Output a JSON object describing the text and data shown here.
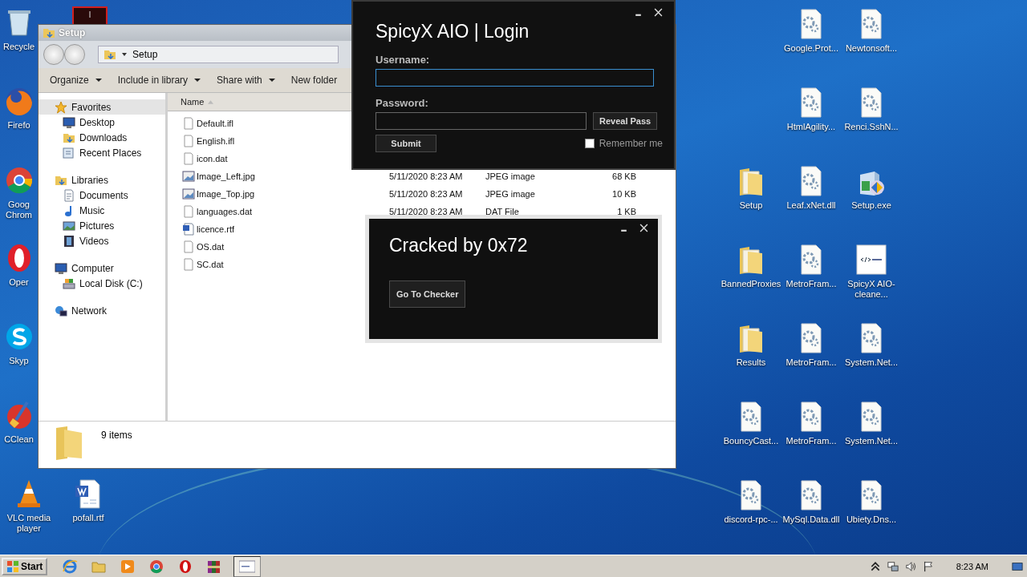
{
  "desktop_left": [
    {
      "label": "Recycle",
      "kind": "recycle"
    },
    {
      "label": "Firefo",
      "kind": "firefox"
    },
    {
      "label": "Goog Chrom",
      "kind": "chrome"
    },
    {
      "label": "Oper",
      "kind": "opera"
    },
    {
      "label": "Skyp",
      "kind": "skype"
    },
    {
      "label": "CClean",
      "kind": "ccleaner"
    },
    {
      "label": "VLC media player",
      "kind": "vlc"
    },
    {
      "label": "pofall.rtf",
      "kind": "word"
    }
  ],
  "desktop_right": [
    {
      "label": "Setup",
      "kind": "folder"
    },
    {
      "label": "BannedProxies",
      "kind": "folder"
    },
    {
      "label": "Results",
      "kind": "folder"
    },
    {
      "label": "BouncyCast...",
      "kind": "dll"
    },
    {
      "label": "discord-rpc-...",
      "kind": "dll"
    },
    {
      "label": "Google.Prot...",
      "kind": "dll"
    },
    {
      "label": "HtmlAgility...",
      "kind": "dll"
    },
    {
      "label": "Leaf.xNet.dll",
      "kind": "dll"
    },
    {
      "label": "MetroFram...",
      "kind": "dll"
    },
    {
      "label": "MetroFram...",
      "kind": "dll"
    },
    {
      "label": "MetroFram...",
      "kind": "dll"
    },
    {
      "label": "MySql.Data.dll",
      "kind": "dll"
    },
    {
      "label": "Newtonsoft...",
      "kind": "dll"
    },
    {
      "label": "Renci.SshN...",
      "kind": "dll"
    },
    {
      "label": "Setup.exe",
      "kind": "installer"
    },
    {
      "label": "SpicyX AIO-cleane...",
      "kind": "spicyx"
    },
    {
      "label": "System.Net...",
      "kind": "dll"
    },
    {
      "label": "System.Net...",
      "kind": "dll"
    },
    {
      "label": "Ubiety.Dns...",
      "kind": "dll"
    }
  ],
  "explorer": {
    "title": "Setup",
    "address": "Setup",
    "toolbar": [
      {
        "label": "Organize",
        "dropdown": true
      },
      {
        "label": "Include in library",
        "dropdown": true
      },
      {
        "label": "Share with",
        "dropdown": true
      },
      {
        "label": "New folder",
        "dropdown": false
      }
    ],
    "sidebar": [
      {
        "label": "Favorites",
        "kind": "star",
        "selected": true,
        "children": [
          {
            "label": "Desktop",
            "kind": "desktop",
            "selected": false
          },
          {
            "label": "Downloads",
            "kind": "downloads",
            "selected": false
          },
          {
            "label": "Recent Places",
            "kind": "recent",
            "selected": false
          }
        ]
      },
      {
        "label": "Libraries",
        "kind": "libraries",
        "selected": false,
        "children": [
          {
            "label": "Documents",
            "kind": "documents",
            "selected": false
          },
          {
            "label": "Music",
            "kind": "music",
            "selected": false
          },
          {
            "label": "Pictures",
            "kind": "pictures",
            "selected": false
          },
          {
            "label": "Videos",
            "kind": "videos",
            "selected": false
          }
        ]
      },
      {
        "label": "Computer",
        "kind": "computer",
        "selected": false,
        "children": [
          {
            "label": "Local Disk (C:)",
            "kind": "disk",
            "selected": false
          }
        ]
      },
      {
        "label": "Network",
        "kind": "network",
        "selected": false
      }
    ],
    "column_name": "Name",
    "files": [
      {
        "name": "Default.ifl",
        "kind": "file"
      },
      {
        "name": "English.ifl",
        "kind": "file"
      },
      {
        "name": "icon.dat",
        "kind": "file"
      },
      {
        "name": "Image_Left.jpg",
        "kind": "image",
        "date": "5/11/2020 8:23 AM",
        "type": "JPEG image",
        "size": "68 KB"
      },
      {
        "name": "Image_Top.jpg",
        "kind": "image",
        "date": "5/11/2020 8:23 AM",
        "type": "JPEG image",
        "size": "10 KB"
      },
      {
        "name": "languages.dat",
        "kind": "file",
        "date": "5/11/2020 8:23 AM",
        "type": "DAT File",
        "size": "1 KB"
      },
      {
        "name": "licence.rtf",
        "kind": "word"
      },
      {
        "name": "OS.dat",
        "kind": "file"
      },
      {
        "name": "SC.dat",
        "kind": "file"
      }
    ],
    "status": "9 items"
  },
  "login": {
    "title": "SpicyX AIO | Login",
    "username_label": "Username:",
    "password_label": "Password:",
    "username_focused": true,
    "reveal": "Reveal Pass",
    "submit": "Submit",
    "remember": {
      "label": "Remember me",
      "checked": false
    }
  },
  "cracked": {
    "title": "Cracked by 0x72",
    "button": "Go To Checker"
  },
  "taskbar": {
    "start": "Start",
    "apps": [
      {
        "kind": "ie",
        "selected": false
      },
      {
        "kind": "explorer",
        "selected": false
      },
      {
        "kind": "media",
        "selected": false
      },
      {
        "kind": "chrome",
        "selected": false
      },
      {
        "kind": "opera",
        "selected": false
      },
      {
        "kind": "winrar",
        "selected": false
      },
      {
        "kind": "window",
        "selected": true
      }
    ],
    "clock": "8:23 AM"
  }
}
